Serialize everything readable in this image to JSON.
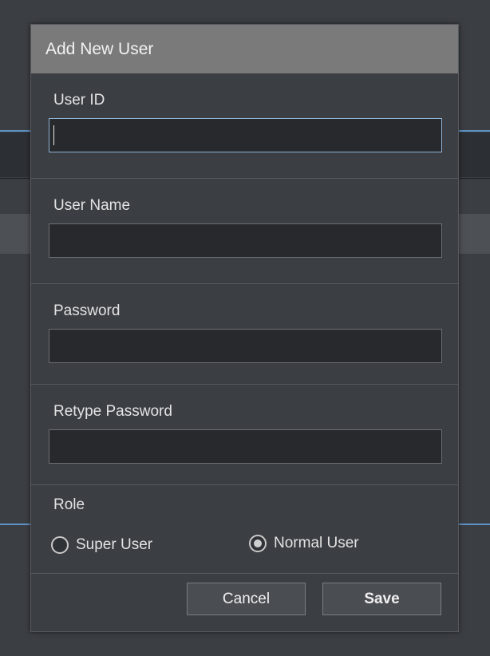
{
  "dialog": {
    "title": "Add New User"
  },
  "fields": {
    "user_id": {
      "label": "User ID",
      "value": ""
    },
    "user_name": {
      "label": "User Name",
      "value": ""
    },
    "password": {
      "label": "Password",
      "value": ""
    },
    "retype_password": {
      "label": "Retype Password",
      "value": ""
    }
  },
  "role": {
    "label": "Role",
    "options": [
      {
        "label": "Super User",
        "selected": false
      },
      {
        "label": "Normal User",
        "selected": true
      }
    ]
  },
  "buttons": {
    "cancel_label": "Cancel",
    "save_label": "Save"
  },
  "colors": {
    "title_bar": "#7a7a7a",
    "dialog_bg": "#3b3e43",
    "input_bg": "#27292c",
    "focus_border": "#8eb4d8"
  }
}
